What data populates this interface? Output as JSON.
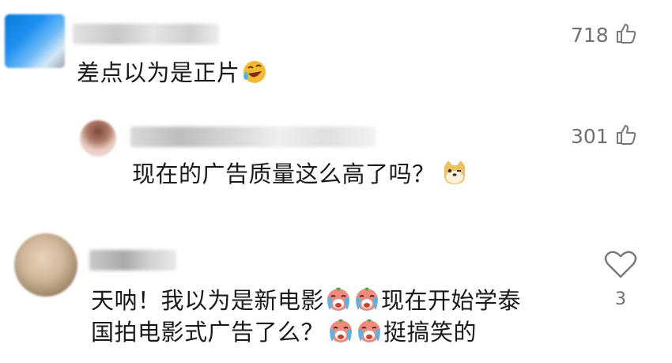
{
  "comments": [
    {
      "text": "差点以为是正片",
      "emoji": "rofl-emoji",
      "likes": "718"
    },
    {
      "text": "现在的广告质量这么高了吗？",
      "emoji": "doge-emoji",
      "likes": "301"
    },
    {
      "line1_a": "天呐！我以为是新电影",
      "line1_b": "现在开始学泰",
      "line2_a": "国拍电影式广告了么？",
      "line2_b": "挺搞笑的",
      "emoji": "crying-face-emoji",
      "likes": "3"
    }
  ],
  "colors": {
    "text": "#1a1a1a",
    "count": "#707070",
    "icon": "#777777"
  }
}
